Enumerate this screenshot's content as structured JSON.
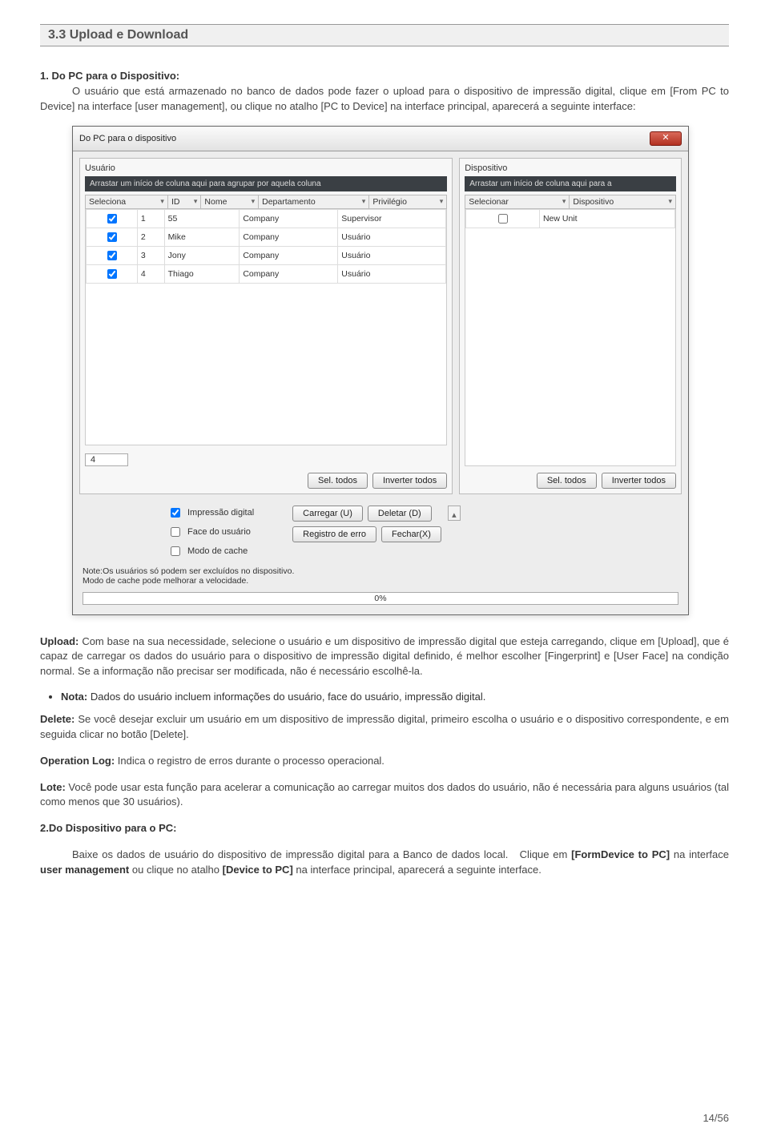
{
  "section_title": "3.3 Upload e Download",
  "para1_lead": "1. Do PC para o Dispositivo:",
  "para1_text": "O usuário que está armazenado no banco de dados pode fazer o upload para o dispositivo de impressão digital, clique em [From PC to Device] na interface [user management], ou clique no atalho [PC to Device] na interface principal, aparecerá a seguinte interface:",
  "dialog": {
    "title": "Do PC para o dispositivo",
    "close": "✕",
    "left": {
      "label": "Usuário",
      "groupbar": "Arrastar um início de coluna aqui para agrupar por aquela coluna",
      "headers": [
        "Seleciona",
        "ID",
        "Nome",
        "Departamento",
        "Privilégio"
      ],
      "rows": [
        {
          "sel": true,
          "id": "1",
          "nome": "55",
          "dep": "Company",
          "priv": "Supervisor"
        },
        {
          "sel": true,
          "id": "2",
          "nome": "Mike",
          "dep": "Company",
          "priv": "Usuário"
        },
        {
          "sel": true,
          "id": "3",
          "nome": "Jony",
          "dep": "Company",
          "priv": "Usuário"
        },
        {
          "sel": true,
          "id": "4",
          "nome": "Thiago",
          "dep": "Company",
          "priv": "Usuário"
        }
      ],
      "counter": "4",
      "btn_sel": "Sel. todos",
      "btn_inv": "Inverter todos"
    },
    "right": {
      "label": "Dispositivo",
      "groupbar": "Arrastar um início de coluna aqui para a",
      "headers": [
        "Selecionar",
        "Dispositivo"
      ],
      "rows": [
        {
          "sel": false,
          "dev": "New Unit"
        }
      ],
      "btn_sel": "Sel. todos",
      "btn_inv": "Inverter todos"
    },
    "opts": {
      "chk1": "Impressão digital",
      "chk2": "Face do usuário",
      "chk3": "Modo de cache",
      "btn_upload": "Carregar (U)",
      "btn_delete": "Deletar (D)",
      "btn_errlog": "Registro de erro",
      "btn_close": "Fechar(X)"
    },
    "note1": "Note:Os usuários só podem ser excluídos no dispositivo.",
    "note2": "Modo de cache pode melhorar a velocidade.",
    "progress": "0%"
  },
  "upload_para": "Com base na sua necessidade, selecione o usuário e um dispositivo de impressão digital que esteja carregando, clique em [Upload], que é capaz de carregar os dados do usuário para o dispositivo de impressão digital definido, é melhor escolher [Fingerprint] e [User Face] na condição normal. Se a informação não precisar ser modificada, não é necessário escolhê-la.",
  "upload_label": "Upload:",
  "bullet_nota": "Nota: Dados do usuário incluem informações do usuário, face do usuário, impressão digital.",
  "delete_label": "Delete:",
  "delete_text": " Se você desejar excluir um usuário em um dispositivo de impressão digital, primeiro escolha o usuário e o dispositivo correspondente, e em seguida clicar no botão [Delete].",
  "oplog_label": "Operation Log:",
  "oplog_text": " Indica o registro de erros durante o processo operacional.",
  "lote_label": "Lote:",
  "lote_text": " Você pode usar esta função para acelerar a comunicação ao carregar muitos dos dados do usuário, não é necessária para alguns usuários (tal como menos que 30 usuários).",
  "heading2": "2.Do Dispositivo para o PC:",
  "para2": "Baixe os dados de usuário do dispositivo de impressão digital para a Banco de dados local.  Clique em [FormDevice to PC] na interface user management ou clique no atalho [Device to PC] na interface principal, aparecerá a seguinte interface.",
  "page": "14/56"
}
